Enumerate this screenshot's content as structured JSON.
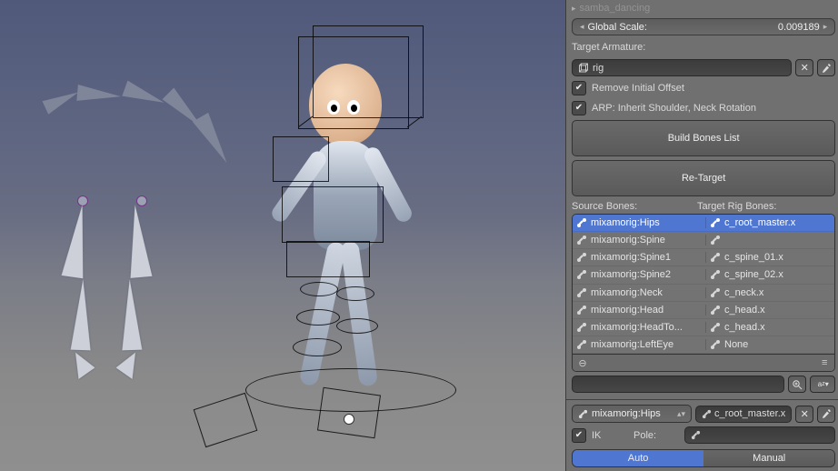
{
  "viewport": {
    "description": "Blender 3D viewport showing a stylized child character with brown hair and a metallic grey bodysuit in an action pose. The character's Auto-Rig Pro control rig is visible as black wireframe boxes, spheres and rings. To the left, two grey Mixamo source armatures (stick-figure bone skeletons) are posed mid-motion. The floor is implied by a horizon gradient."
  },
  "header_collapsed_slider": {
    "label": "samba_dancing",
    "icon": "triangle-right"
  },
  "global_scale": {
    "label": "Global Scale:",
    "value": "0.009189"
  },
  "target_armature": {
    "label": "Target Armature:",
    "value": "rig",
    "object_icon": "cube-wire-icon"
  },
  "checkboxes": {
    "remove_initial_offset": {
      "label": "Remove Initial Offset",
      "checked": true
    },
    "arp_inherit": {
      "label": "ARP: Inherit Shoulder, Neck Rotation",
      "checked": true
    }
  },
  "buttons": {
    "build_bones": "Build Bones List",
    "retarget": "Re-Target"
  },
  "columns": {
    "source": "Source Bones:",
    "target": "Target Rig Bones:"
  },
  "bone_map": [
    {
      "src": "mixamorig:Hips",
      "tgt": "c_root_master.x",
      "selected": true
    },
    {
      "src": "mixamorig:Spine",
      "tgt": "",
      "selected": false
    },
    {
      "src": "mixamorig:Spine1",
      "tgt": "c_spine_01.x",
      "selected": false
    },
    {
      "src": "mixamorig:Spine2",
      "tgt": "c_spine_02.x",
      "selected": false
    },
    {
      "src": "mixamorig:Neck",
      "tgt": "c_neck.x",
      "selected": false
    },
    {
      "src": "mixamorig:Head",
      "tgt": "c_head.x",
      "selected": false
    },
    {
      "src": "mixamorig:HeadTo...",
      "tgt": "c_head.x",
      "selected": false
    },
    {
      "src": "mixamorig:LeftEye",
      "tgt": "None",
      "selected": false
    }
  ],
  "list_footer": {
    "collapse_icon": "–",
    "grip_icon": "≡"
  },
  "filter": {
    "search_placeholder": "",
    "zoom_btn": "zoom-icon",
    "sort_btn": "az-down-icon"
  },
  "active_pair": {
    "source_value": "mixamorig:Hips",
    "target_value": "c_root_master.x"
  },
  "ik_row": {
    "ik_label": "IK",
    "ik_checked": true,
    "pole_label": "Pole:",
    "pole_value": ""
  },
  "mode_toggle": {
    "left": "Auto",
    "right": "Manual",
    "active": "Auto"
  }
}
